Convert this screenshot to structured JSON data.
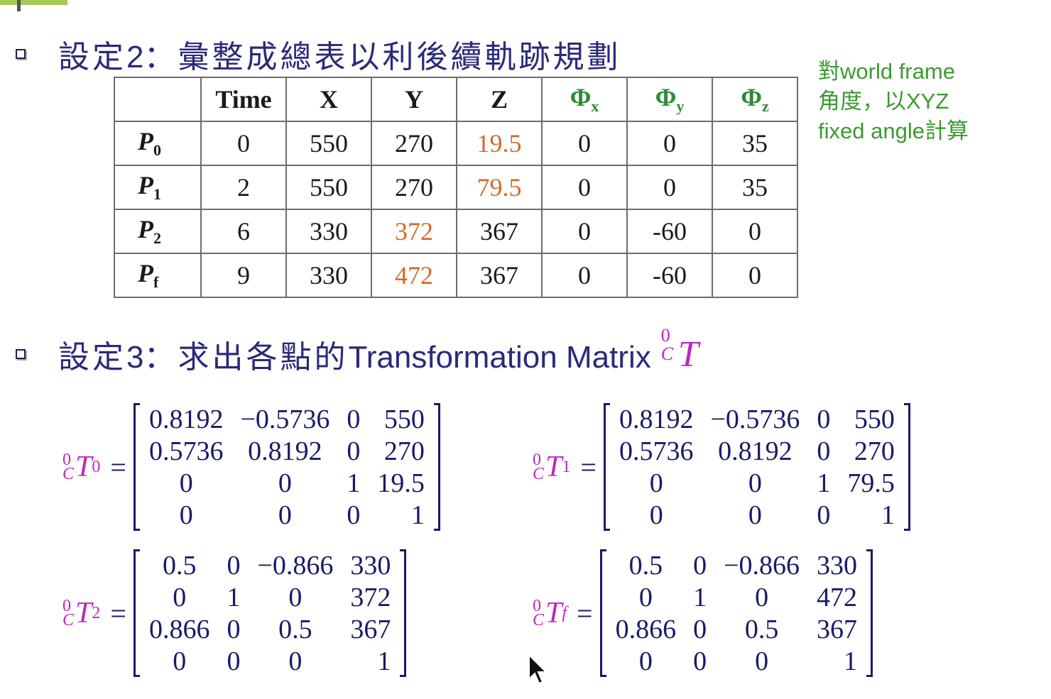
{
  "heading2": {
    "prefix": "設定",
    "number": "2",
    "rest": "：彙整成總表以利後續軌跡規劃"
  },
  "note": {
    "line1": "對world frame",
    "line2": "角度，以XYZ",
    "line3": "fixed angle計算"
  },
  "table": {
    "headers": [
      "",
      "Time",
      "X",
      "Y",
      "Z",
      "Φ",
      "Φ",
      "Φ"
    ],
    "phi_subscripts": [
      "x",
      "y",
      "z"
    ],
    "row_labels": [
      {
        "base": "P",
        "sub": "0"
      },
      {
        "base": "P",
        "sub": "1"
      },
      {
        "base": "P",
        "sub": "2"
      },
      {
        "base": "P",
        "sub": "f"
      }
    ],
    "rows": [
      [
        "0",
        "550",
        "270",
        "19.5",
        "0",
        "0",
        "35"
      ],
      [
        "2",
        "550",
        "270",
        "79.5",
        "0",
        "0",
        "35"
      ],
      [
        "6",
        "330",
        "372",
        "367",
        "0",
        "-60",
        "0"
      ],
      [
        "9",
        "330",
        "472",
        "367",
        "0",
        "-60",
        "0"
      ]
    ],
    "highlight_color": "#d26a2a"
  },
  "heading3": {
    "prefix": "設定",
    "number": "3",
    "chinese": "：求出各點的",
    "english": "Transformation Matrix",
    "symbol_sup": "0",
    "symbol_sub": "C",
    "symbol": "T"
  },
  "matrices": [
    {
      "sup": "0",
      "pre_sub": "C",
      "base": "T",
      "sub": "0",
      "equals": "=",
      "rows": [
        [
          "0.8192",
          "−0.5736",
          "0",
          "550"
        ],
        [
          "0.5736",
          "0.8192",
          "0",
          "270"
        ],
        [
          "0",
          "0",
          "1",
          "19.5"
        ],
        [
          "0",
          "0",
          "0",
          "1"
        ]
      ]
    },
    {
      "sup": "0",
      "pre_sub": "C",
      "base": "T",
      "sub": "1",
      "equals": "=",
      "rows": [
        [
          "0.8192",
          "−0.5736",
          "0",
          "550"
        ],
        [
          "0.5736",
          "0.8192",
          "0",
          "270"
        ],
        [
          "0",
          "0",
          "1",
          "79.5"
        ],
        [
          "0",
          "0",
          "0",
          "1"
        ]
      ]
    },
    {
      "sup": "0",
      "pre_sub": "C",
      "base": "T",
      "sub": "2",
      "equals": "=",
      "rows": [
        [
          "0.5",
          "0",
          "−0.866",
          "330"
        ],
        [
          "0",
          "1",
          "0",
          "372"
        ],
        [
          "0.866",
          "0",
          "0.5",
          "367"
        ],
        [
          "0",
          "0",
          "0",
          "1"
        ]
      ]
    },
    {
      "sup": "0",
      "pre_sub": "C",
      "base": "T",
      "sub": "f",
      "equals": "=",
      "rows": [
        [
          "0.5",
          "0",
          "−0.866",
          "330"
        ],
        [
          "0",
          "1",
          "0",
          "472"
        ],
        [
          "0.866",
          "0",
          "0.5",
          "367"
        ],
        [
          "0",
          "0",
          "0",
          "1"
        ]
      ]
    }
  ],
  "colors": {
    "heading": "#2a2a7a",
    "note": "#3a9b2f",
    "phi_header": "#2e8b3a",
    "symbol": "#c026c0",
    "matrix": "#1a1a6a"
  }
}
